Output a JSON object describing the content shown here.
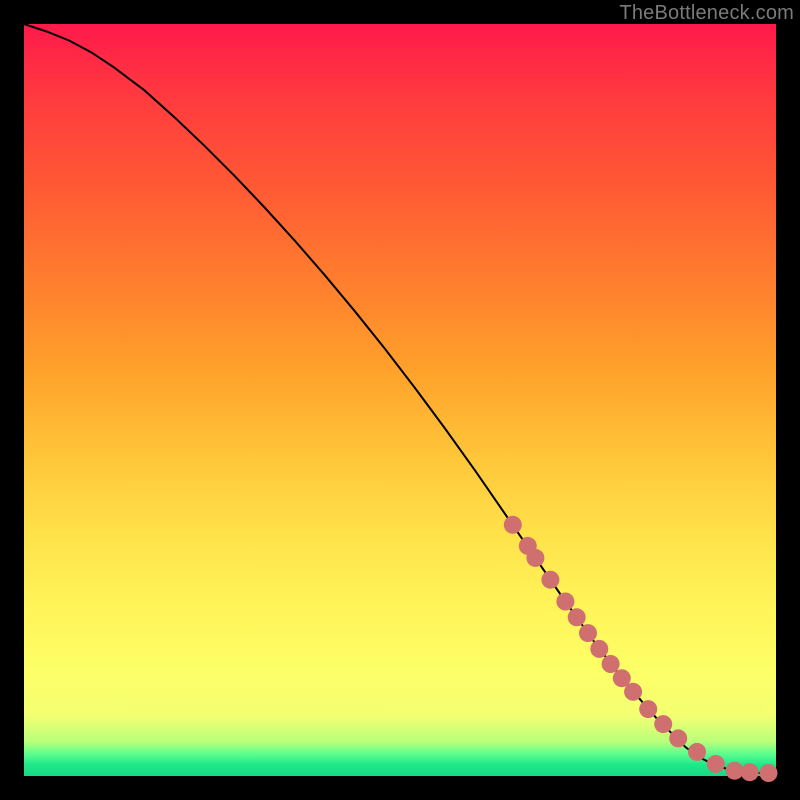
{
  "watermark": "TheBottleneck.com",
  "colors": {
    "curve": "#000000",
    "marker_fill": "#cf6f6f",
    "marker_stroke": "#cf6f6f",
    "background_black": "#000000"
  },
  "chart_data": {
    "type": "line",
    "title": "",
    "xlabel": "",
    "ylabel": "",
    "xlim": [
      0,
      100
    ],
    "ylim": [
      0,
      100
    ],
    "grid": false,
    "legend": false,
    "series": [
      {
        "name": "bottleneck-curve",
        "x": [
          0,
          3,
          6,
          9,
          12,
          16,
          20,
          24,
          28,
          32,
          36,
          40,
          44,
          48,
          52,
          56,
          60,
          64,
          68,
          72,
          76,
          80,
          84,
          88,
          90,
          92,
          94,
          96,
          98,
          100
        ],
        "y": [
          100,
          99,
          97.8,
          96.2,
          94.2,
          91.2,
          87.6,
          83.8,
          79.8,
          75.6,
          71.2,
          66.6,
          61.8,
          56.8,
          51.6,
          46.2,
          40.6,
          34.8,
          29.0,
          23.2,
          17.6,
          12.4,
          7.8,
          3.8,
          2.4,
          1.4,
          0.8,
          0.5,
          0.4,
          0.4
        ]
      }
    ],
    "markers": {
      "name": "data-points",
      "x": [
        65,
        67,
        68,
        70,
        72,
        73.5,
        75,
        76.5,
        78,
        79.5,
        81,
        83,
        85,
        87,
        89.5,
        92,
        94.5,
        96.5,
        99
      ],
      "y": [
        33.4,
        30.6,
        29.0,
        26.1,
        23.2,
        21.1,
        19.0,
        16.9,
        14.9,
        13.0,
        11.2,
        8.9,
        6.9,
        5.0,
        3.2,
        1.6,
        0.7,
        0.5,
        0.4
      ]
    }
  }
}
